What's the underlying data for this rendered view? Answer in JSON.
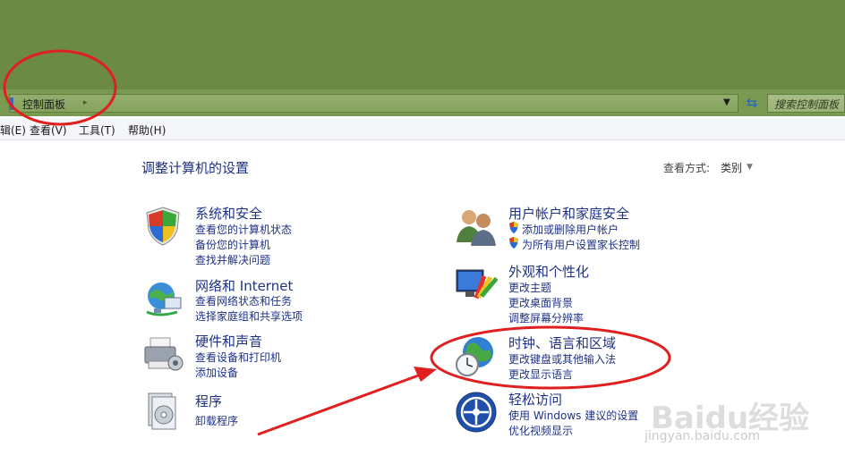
{
  "address_bar": {
    "breadcrumb": "控制面板",
    "search_placeholder": "搜索控制面板"
  },
  "menu": {
    "edit": "辑(E)",
    "view": "查看(V)",
    "tools": "工具(T)",
    "help": "帮助(H)"
  },
  "main": {
    "heading": "调整计算机的设置",
    "view_by_label": "查看方式:",
    "view_by_value": "类别"
  },
  "categories": {
    "security": {
      "title": "系统和安全",
      "links": [
        "查看您的计算机状态",
        "备份您的计算机",
        "查找并解决问题"
      ]
    },
    "network": {
      "title": "网络和 Internet",
      "links": [
        "查看网络状态和任务",
        "选择家庭组和共享选项"
      ]
    },
    "hardware": {
      "title": "硬件和声音",
      "links": [
        "查看设备和打印机",
        "添加设备"
      ]
    },
    "programs": {
      "title": "程序",
      "links": [
        "卸载程序"
      ]
    },
    "users": {
      "title": "用户帐户和家庭安全",
      "links": [
        "添加或删除用户帐户",
        "为所有用户设置家长控制"
      ]
    },
    "appearance": {
      "title": "外观和个性化",
      "links": [
        "更改主题",
        "更改桌面背景",
        "调整屏幕分辨率"
      ]
    },
    "clock": {
      "title": "时钟、语言和区域",
      "links": [
        "更改键盘或其他输入法",
        "更改显示语言"
      ]
    },
    "ease": {
      "title": "轻松访问",
      "links": [
        "使用 Windows 建议的设置",
        "优化视频显示"
      ]
    }
  },
  "watermark": {
    "brand": "Baidu经验",
    "url": "jingyan.baidu.com"
  },
  "colors": {
    "title_green": "#6b8a44",
    "link_blue": "#1e3287",
    "annotation_red": "#e02020"
  }
}
